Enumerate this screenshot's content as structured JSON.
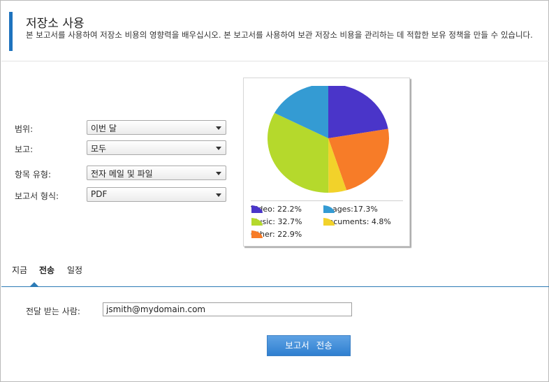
{
  "header": {
    "title": "저장소 사용",
    "description": "본 보고서를 사용하여 저장소 비용의 영향력을 배우십시오. 본 보고서를 사용하여 보관 저장소 비용을 관리하는 데 적합한 보유 정책을 만들 수 있습니다."
  },
  "form": {
    "scope": {
      "label": "범위:",
      "value": "이번 달"
    },
    "report": {
      "label": "보고:",
      "value": "모두"
    },
    "item_type": {
      "label": "항목 유형:",
      "value": "전자 메일 및 파일"
    },
    "format": {
      "label": "보고서 형식:",
      "value": "PDF"
    }
  },
  "chart_data": {
    "type": "pie",
    "slices": [
      {
        "name": "Video",
        "label": "Video: 22.2%",
        "value": 22.2,
        "color": "#4a35c9"
      },
      {
        "name": "Other",
        "label": "Other: 22.9%",
        "value": 22.9,
        "color": "#f77c28"
      },
      {
        "name": "Documents",
        "label": "Documents: 4.8%",
        "value": 4.8,
        "color": "#f2d22a"
      },
      {
        "name": "Music",
        "label": "Music: 32.7%",
        "value": 32.7,
        "color": "#b5d92c"
      },
      {
        "name": "Images",
        "label": "Images:17.3%",
        "value": 17.3,
        "color": "#349bd3"
      }
    ],
    "legend_order": [
      "Video",
      "Images",
      "Music",
      "Documents",
      "Other"
    ],
    "legend_position": "bottom"
  },
  "tabs": [
    {
      "label": "지금",
      "active": false
    },
    {
      "label": "전송",
      "active": true
    },
    {
      "label": "일정",
      "active": false
    }
  ],
  "send": {
    "recipient_label": "전달 받는 사람:",
    "recipient_value": "jsmith@mydomain.com",
    "button_label": "보고서 전송"
  },
  "colors": {
    "accent": "#1e73be",
    "button": "#3b87d4",
    "tab_rule": "#2c7bb6"
  }
}
